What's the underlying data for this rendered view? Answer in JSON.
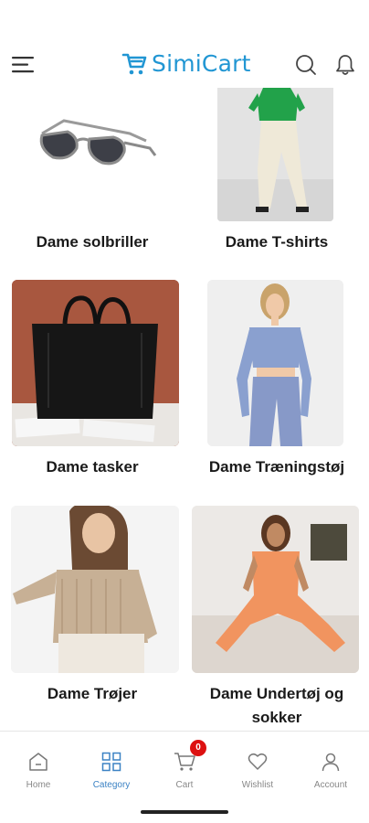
{
  "app": {
    "logo_text": "SimiCart"
  },
  "categories": [
    {
      "label": "Dame solbriller"
    },
    {
      "label": "Dame T-shirts"
    },
    {
      "label": "Dame tasker"
    },
    {
      "label": "Dame Træningstøj"
    },
    {
      "label": "Dame Trøjer"
    },
    {
      "label": "Dame Undertøj og sokker"
    }
  ],
  "bottom_nav": {
    "items": [
      {
        "label": "Home",
        "icon": "home-icon"
      },
      {
        "label": "Category",
        "icon": "category-icon",
        "active": true
      },
      {
        "label": "Cart",
        "icon": "cart-icon",
        "badge": "0"
      },
      {
        "label": "Wishlist",
        "icon": "heart-icon"
      },
      {
        "label": "Account",
        "icon": "account-icon"
      }
    ]
  },
  "colors": {
    "accent": "#2196d3",
    "nav_active": "#3b82c4",
    "badge": "#dd1111"
  }
}
